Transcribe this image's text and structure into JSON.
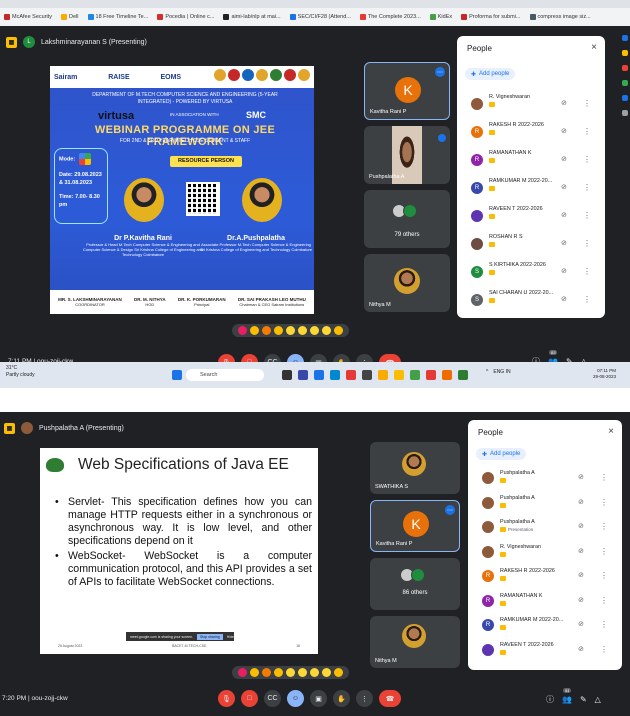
{
  "browser": {
    "bookmarks": [
      "McAfee Security",
      "Dell",
      "18 Free Timeline Te...",
      "Pocedia | Online c...",
      "aimi-lab/nlp at mai...",
      "SEC/CI/F28 (Attend...",
      "The Complete 2023...",
      "KidEx",
      "Proforma for submi...",
      "compress image siz..."
    ]
  },
  "top": {
    "presenting": "Lakshminarayanan S (Presenting)",
    "presenter_initial": "L",
    "slide": {
      "logos": [
        "Sairam",
        "RAISE",
        "EOMS"
      ],
      "dept": "DEPARTMENT OF M.TECH COMPUTER SCIENCE AND ENGINEERING (5-YEAR INTEGRATED) - POWERED BY VIRTUSA",
      "virtusa": "virtusa",
      "assoc": "IN ASSOCIATION WITH",
      "smc": "SMC",
      "title": "WEBINAR PROGRAMME ON JEE FRAMEWORK",
      "subtitle": "FOR 2ND & 3RD YEAR MTECH CSE STUDENT & STAFF",
      "resource": "RESOURCE PERSON",
      "mode_label": "Mode:",
      "date": "Date: 29.08.2023 & 31.08.2023",
      "time": "Time: 7.00- 8.30 pm",
      "speaker1_name": "Dr P.Kavitha Rani",
      "speaker1_desc": "Professor & Head M.Tech Computer Science & Engineering and Computer Science & Design Sri Krishna College of Engineering and Technology Coimbatore",
      "speaker2_name": "Dr.A.Pushpalatha",
      "speaker2_desc": "Associate Professor M.Tech Computer Science & Engineering Sri Krishna College of Engineering and Technology Coimbatore",
      "footer": [
        {
          "name": "MR. S. LAKSHMINARAYANAN",
          "role": "COORDINATOR"
        },
        {
          "name": "DR. M. NITHYA",
          "role": "HOD"
        },
        {
          "name": "DR. K. PORKUMARAN",
          "role": "Principal"
        },
        {
          "name": "DR. SAI PRAKASH LEO MUTHU",
          "role": "Chairman & CEO Sairam Institutions"
        }
      ]
    },
    "tiles": {
      "t1_initial": "K",
      "t1_name": "Kavitha Rani P",
      "t2_name": "Pushpalatha A",
      "t3_count": "79 others",
      "t3_initial": "L",
      "t4_name": "Nithya M"
    },
    "panel": {
      "title": "People",
      "close": "×",
      "add": "Add people",
      "people": [
        {
          "initial": "",
          "name": "R. Vigneshwaran",
          "color": "#8d5a3b"
        },
        {
          "initial": "R",
          "name": "RAKESH R 2022-2026",
          "color": "#e8710a"
        },
        {
          "initial": "R",
          "name": "RAMANATHAN K",
          "color": "#8e24aa"
        },
        {
          "initial": "R",
          "name": "RAMKUMAR M 2022-20...",
          "color": "#3949ab"
        },
        {
          "initial": "",
          "name": "RAVEEN T 2022-2026",
          "color": "#5e35b1"
        },
        {
          "initial": "",
          "name": "ROSHAN R S",
          "color": "#6d4c41"
        },
        {
          "initial": "S",
          "name": "S KIRTHIKA 2022-2026",
          "color": "#1e8e3e"
        },
        {
          "initial": "S",
          "name": "SAI CHARAN U 2022-20...",
          "color": "#5f6368"
        }
      ]
    },
    "time": "7:11 PM",
    "code": "oou-zojj-ckw",
    "people_count": "83",
    "taskbar": {
      "temp": "31°C",
      "weather": "Partly cloudy",
      "search": "Search",
      "lang": "ENG",
      "region": "IN",
      "clock_time": "07:11 PM",
      "clock_date": "29-08-2023"
    }
  },
  "bottom": {
    "presenting": "Pushpalatha A (Presenting)",
    "slide": {
      "title": "Web Specifications of Java EE",
      "bullet1": "Servlet- This specification defines how you can manage HTTP requests either in a synchronous or asynchronous way. It is low level, and other specifications depend on it",
      "bullet2": "WebSocket- WebSocket is a computer communication protocol, and this API provides a set of APIs to facilitate WebSocket connections.",
      "share_text": "meet.google.com is sharing your screen.",
      "stop": "Stop sharing",
      "hide": "Hide",
      "date": "26 August 2023",
      "dept": "BACE7-M.TECH-CSE",
      "page": "16"
    },
    "tiles": {
      "t1_name": "SWATHIKA S",
      "t2_initial": "K",
      "t2_name": "Kavitha Rani P",
      "t3_count": "86 others",
      "t3_initial": "L",
      "t4_name": "Nithya M"
    },
    "panel": {
      "title": "People",
      "close": "×",
      "add": "Add people",
      "people": [
        {
          "initial": "",
          "name": "Pushpalatha A",
          "sub": "",
          "color": "#8d5a3b"
        },
        {
          "initial": "",
          "name": "Pushpalatha A",
          "sub": "",
          "color": "#8d5a3b"
        },
        {
          "initial": "",
          "name": "Pushpalatha A",
          "sub": "Presentation",
          "color": "#8d5a3b"
        },
        {
          "initial": "",
          "name": "R. Vigneshwaran",
          "sub": "",
          "color": "#8d5a3b"
        },
        {
          "initial": "R",
          "name": "RAKESH R 2022-2026",
          "sub": "",
          "color": "#e8710a"
        },
        {
          "initial": "R",
          "name": "RAMANATHAN K",
          "sub": "",
          "color": "#8e24aa"
        },
        {
          "initial": "R",
          "name": "RAMKUMAR M 2022-20...",
          "sub": "",
          "color": "#3949ab"
        },
        {
          "initial": "",
          "name": "RAVEEN T 2022-2026",
          "sub": "",
          "color": "#5e35b1"
        }
      ]
    },
    "time": "7:20 PM",
    "code": "oou-zojj-ckw",
    "people_count": "91"
  }
}
